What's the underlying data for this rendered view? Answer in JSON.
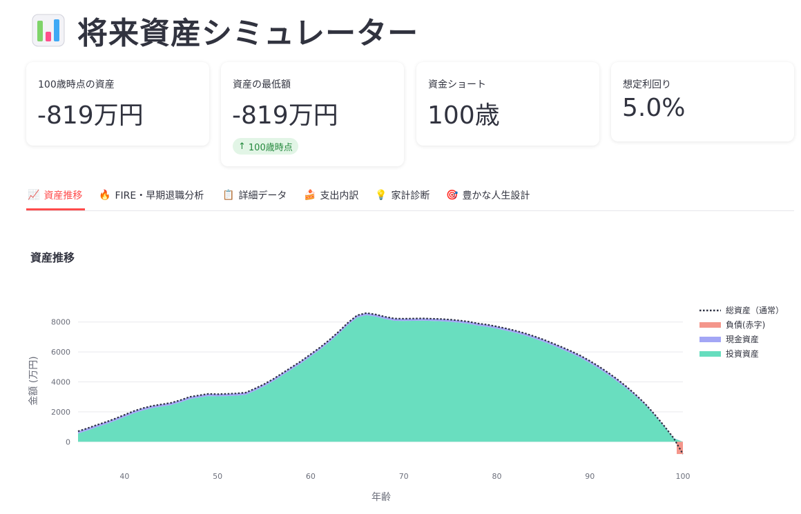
{
  "app": {
    "title": "将来資産シミュレーター",
    "title_icon": "bar-chart-icon"
  },
  "metrics": [
    {
      "label": "100歳時点の資産",
      "value": "-819万円"
    },
    {
      "label": "資産の最低額",
      "value": "-819万円",
      "delta": "100歳時点",
      "delta_icon": "arrow-up-icon"
    },
    {
      "label": "資金ショート",
      "value": "100歳"
    },
    {
      "label": "想定利回り",
      "value": "5.0%"
    }
  ],
  "tabs": [
    {
      "label": "資産推移",
      "icon": "chart-increasing-icon",
      "active": true
    },
    {
      "label": "FIRE・早期退職分析",
      "icon": "fire-icon"
    },
    {
      "label": "詳細データ",
      "icon": "clipboard-icon"
    },
    {
      "label": "支出内訳",
      "icon": "cake-icon"
    },
    {
      "label": "家計診断",
      "icon": "lightbulb-icon"
    },
    {
      "label": "豊かな人生設計",
      "icon": "target-icon"
    }
  ],
  "section": {
    "title": "資産推移"
  },
  "colors": {
    "accent": "#ff4b4b",
    "invest": "#66ddbe",
    "cash": "#a3a6f5",
    "debt": "#f4968b",
    "total": "#2d3142"
  },
  "chart_data": {
    "type": "area",
    "xlabel": "年齢",
    "ylabel": "金額 (万円)",
    "xlim": [
      35,
      100
    ],
    "ylim": [
      -1000,
      9000
    ],
    "xticks": [
      40,
      50,
      60,
      70,
      80,
      90,
      100
    ],
    "yticks": [
      0,
      2000,
      4000,
      6000,
      8000
    ],
    "grid": true,
    "legend_position": "right",
    "x": [
      35,
      36,
      37,
      38,
      39,
      40,
      41,
      42,
      43,
      44,
      45,
      46,
      47,
      48,
      49,
      50,
      51,
      52,
      53,
      54,
      55,
      56,
      57,
      58,
      59,
      60,
      61,
      62,
      63,
      64,
      65,
      66,
      67,
      68,
      69,
      70,
      71,
      72,
      73,
      74,
      75,
      76,
      77,
      78,
      79,
      80,
      81,
      82,
      83,
      84,
      85,
      86,
      87,
      88,
      89,
      90,
      91,
      92,
      93,
      94,
      95,
      96,
      97,
      98,
      99,
      100
    ],
    "series": [
      {
        "name": "総資産（通常）",
        "kind": "line",
        "values": [
          700,
          900,
          1120,
          1320,
          1550,
          1800,
          2050,
          2250,
          2400,
          2500,
          2600,
          2780,
          3000,
          3100,
          3200,
          3180,
          3200,
          3230,
          3280,
          3550,
          3850,
          4200,
          4600,
          5000,
          5400,
          5850,
          6300,
          6800,
          7350,
          7950,
          8450,
          8600,
          8500,
          8350,
          8230,
          8220,
          8230,
          8240,
          8220,
          8200,
          8160,
          8100,
          8020,
          7900,
          7820,
          7700,
          7570,
          7420,
          7250,
          7050,
          6830,
          6580,
          6320,
          6050,
          5750,
          5400,
          5020,
          4600,
          4150,
          3650,
          3100,
          2500,
          1800,
          1050,
          250,
          -819
        ]
      },
      {
        "name": "負債(赤字)",
        "kind": "area",
        "values": [
          0,
          0,
          0,
          0,
          0,
          0,
          0,
          0,
          0,
          0,
          0,
          0,
          0,
          0,
          0,
          0,
          0,
          0,
          0,
          0,
          0,
          0,
          0,
          0,
          0,
          0,
          0,
          0,
          0,
          0,
          0,
          0,
          0,
          0,
          0,
          0,
          0,
          0,
          0,
          0,
          0,
          0,
          0,
          0,
          0,
          0,
          0,
          0,
          0,
          0,
          0,
          0,
          0,
          0,
          0,
          0,
          0,
          0,
          0,
          0,
          0,
          0,
          0,
          0,
          0,
          -819
        ]
      },
      {
        "name": "現金資産",
        "kind": "area",
        "values": [
          150,
          150,
          150,
          150,
          150,
          150,
          150,
          150,
          150,
          150,
          150,
          150,
          150,
          150,
          150,
          150,
          150,
          150,
          150,
          150,
          150,
          150,
          150,
          150,
          150,
          150,
          150,
          150,
          150,
          150,
          150,
          150,
          150,
          150,
          150,
          150,
          150,
          150,
          150,
          150,
          150,
          150,
          150,
          150,
          150,
          150,
          150,
          150,
          150,
          150,
          150,
          150,
          150,
          150,
          150,
          150,
          150,
          150,
          150,
          120,
          100,
          80,
          60,
          40,
          20,
          0
        ]
      },
      {
        "name": "投資資産",
        "kind": "area",
        "values": [
          550,
          750,
          970,
          1170,
          1400,
          1650,
          1900,
          2100,
          2250,
          2350,
          2450,
          2630,
          2850,
          2950,
          3050,
          3030,
          3050,
          3080,
          3130,
          3400,
          3700,
          4050,
          4450,
          4850,
          5250,
          5700,
          6150,
          6650,
          7200,
          7800,
          8300,
          8450,
          8350,
          8200,
          8080,
          8070,
          8080,
          8090,
          8070,
          8050,
          8010,
          7950,
          7870,
          7750,
          7670,
          7550,
          7420,
          7270,
          7100,
          6900,
          6680,
          6430,
          6170,
          5900,
          5600,
          5250,
          4870,
          4450,
          4000,
          3530,
          3000,
          2420,
          1740,
          1010,
          230,
          0
        ]
      }
    ]
  }
}
